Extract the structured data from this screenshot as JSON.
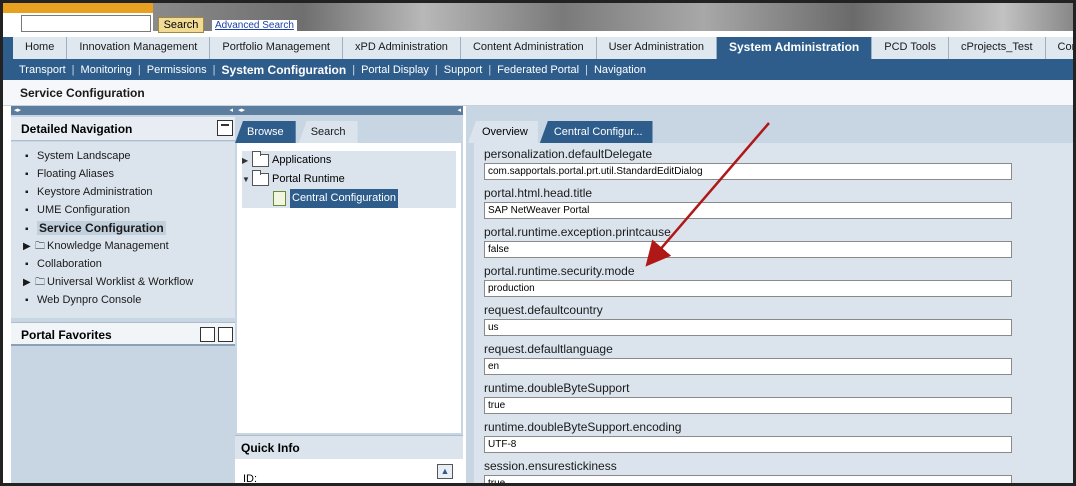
{
  "header": {
    "search_placeholder": "",
    "search_button": "Search",
    "advanced_search": "Advanced Search"
  },
  "tabs": [
    {
      "label": "Home"
    },
    {
      "label": "Innovation Management"
    },
    {
      "label": "Portfolio Management"
    },
    {
      "label": "xPD Administration"
    },
    {
      "label": "Content Administration"
    },
    {
      "label": "User Administration"
    },
    {
      "label": "System Administration",
      "active": true
    },
    {
      "label": "PCD Tools"
    },
    {
      "label": "cProjects_Test"
    },
    {
      "label": "Content M"
    }
  ],
  "subnav": [
    {
      "label": "Transport"
    },
    {
      "label": "Monitoring"
    },
    {
      "label": "Permissions"
    },
    {
      "label": "System Configuration",
      "active": true
    },
    {
      "label": "Portal Display"
    },
    {
      "label": "Support"
    },
    {
      "label": "Federated Portal"
    },
    {
      "label": "Navigation"
    }
  ],
  "page_title": "Service Configuration",
  "detailed_navigation": {
    "title": "Detailed Navigation",
    "items": [
      {
        "label": "System Landscape",
        "type": "bullet"
      },
      {
        "label": "Floating Aliases",
        "type": "bullet"
      },
      {
        "label": "Keystore Administration",
        "type": "bullet"
      },
      {
        "label": "UME Configuration",
        "type": "bullet"
      },
      {
        "label": "Service Configuration",
        "type": "bullet",
        "selected": true
      },
      {
        "label": "Knowledge Management",
        "type": "folder"
      },
      {
        "label": "Collaboration",
        "type": "bullet"
      },
      {
        "label": "Universal Worklist & Workflow",
        "type": "folder"
      },
      {
        "label": "Web Dynpro Console",
        "type": "bullet"
      }
    ]
  },
  "portal_favorites": {
    "title": "Portal Favorites"
  },
  "browse_panel": {
    "tabs": [
      {
        "label": "Browse"
      },
      {
        "label": "Search"
      }
    ],
    "tree": [
      {
        "label": "Applications"
      },
      {
        "label": "Portal Runtime"
      },
      {
        "label": "Central Configuration"
      }
    ]
  },
  "quick_info": {
    "title": "Quick Info",
    "id_label": "ID:"
  },
  "config_panel": {
    "tabs": [
      {
        "label": "Overview"
      },
      {
        "label": "Central Configur..."
      }
    ],
    "properties": [
      {
        "name": "personalization.defaultDelegate",
        "value": "com.sapportals.portal.prt.util.StandardEditDialog"
      },
      {
        "name": "portal.html.head.title",
        "value": "SAP NetWeaver Portal"
      },
      {
        "name": "portal.runtime.exception.printcause",
        "value": "false"
      },
      {
        "name": "portal.runtime.security.mode",
        "value": "production"
      },
      {
        "name": "request.defaultcountry",
        "value": "us"
      },
      {
        "name": "request.defaultlanguage",
        "value": "en"
      },
      {
        "name": "runtime.doubleByteSupport",
        "value": "true"
      },
      {
        "name": "runtime.doubleByteSupport.encoding",
        "value": "UTF-8"
      },
      {
        "name": "session.ensurestickiness",
        "value": "true"
      }
    ]
  },
  "colors": {
    "accent": "#2e5d8c",
    "annotation_arrow": "#b01818"
  }
}
